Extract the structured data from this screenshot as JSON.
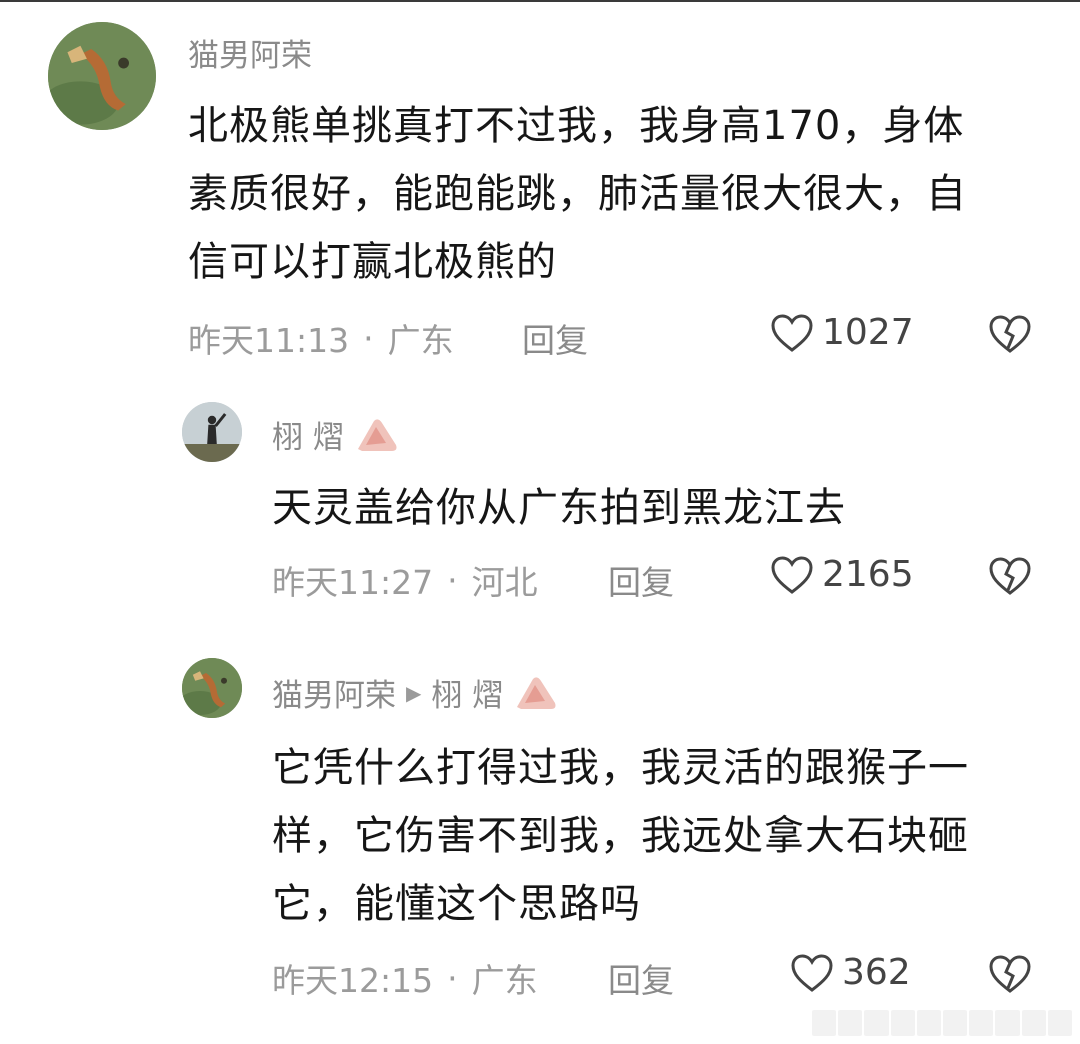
{
  "comments": [
    {
      "username": "猫男阿荣",
      "lines": [
        "北极熊单挑真打不过我，我身高170，身体",
        "素质很好，能跑能跳，肺活量很大很大，自",
        "信可以打赢北极熊的"
      ],
      "time": "昨天11:13",
      "dot": "·",
      "location": "广东",
      "reply_label": "回复",
      "likes": "1027",
      "avatar_icon": "cat-avatar",
      "like_icon": "heart-outline-icon",
      "dislike_icon": "broken-heart-icon"
    },
    {
      "username": "栩 熠",
      "lines": [
        "天灵盖给你从广东拍到黑龙江去"
      ],
      "time": "昨天11:27",
      "dot": "·",
      "location": "河北",
      "reply_label": "回复",
      "likes": "2165",
      "avatar_icon": "person-avatar",
      "badge_icon": "pink-badge-icon"
    },
    {
      "username": "猫男阿荣",
      "reply_to_arrow": "▶",
      "reply_to": "栩 熠",
      "lines": [
        "它凭什么打得过我，我灵活的跟猴子一",
        "样，它伤害不到我，我远处拿大石块砸",
        "它，能懂这个思路吗"
      ],
      "time": "昨天12:15",
      "dot": "·",
      "location": "广东",
      "reply_label": "回复",
      "likes": "362",
      "avatar_icon": "cat-avatar",
      "badge_icon": "pink-badge-icon"
    }
  ],
  "colors": {
    "text": "#161616",
    "meta": "#9b9b9b",
    "username": "#8a8a8a",
    "badge": "#e9a8a0"
  }
}
